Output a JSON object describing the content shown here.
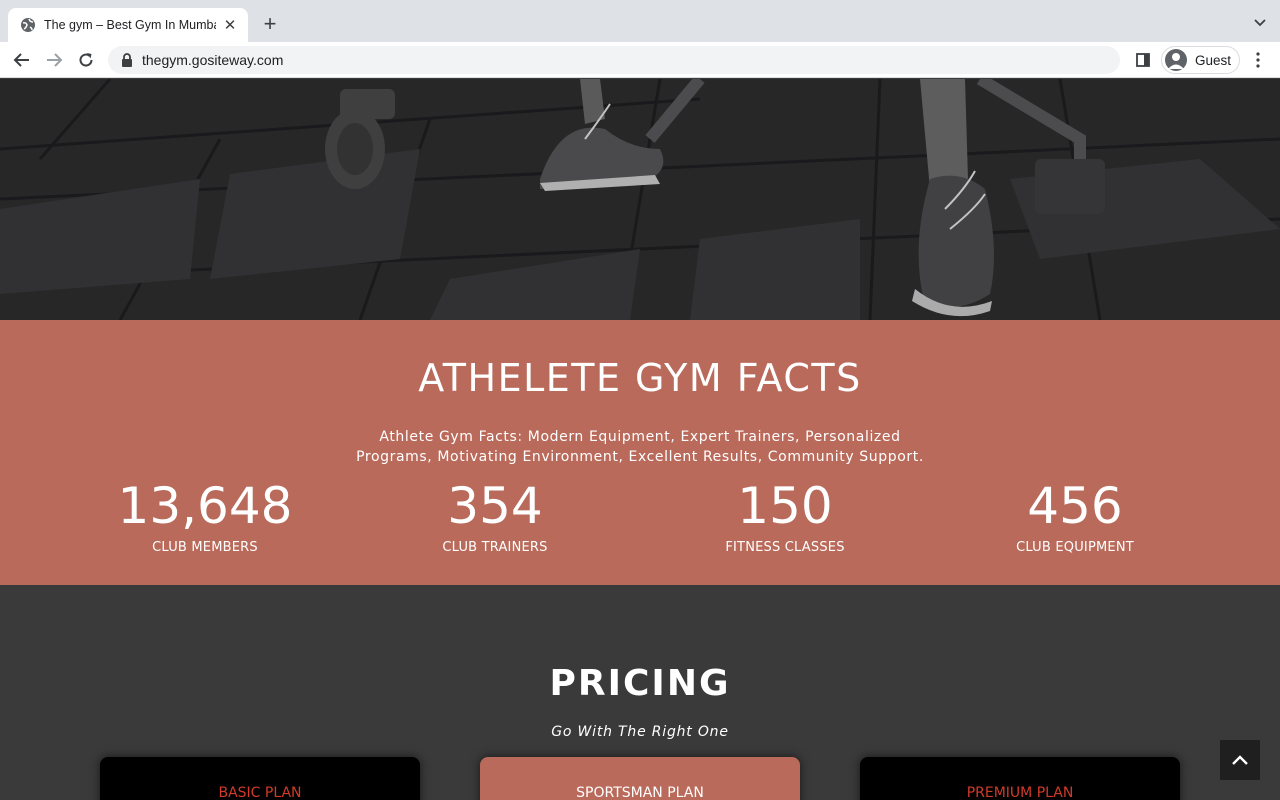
{
  "browser": {
    "tab_title": "The gym – Best Gym In Mumbai",
    "url": "thegym.gositeway.com",
    "profile_name": "Guest"
  },
  "facts": {
    "title": "ATHELETE GYM FACTS",
    "description": "Athlete Gym Facts: Modern Equipment, Expert Trainers, Personalized Programs, Motivating Environment, Excellent Results, Community Support.",
    "stats": [
      {
        "value": "13,648",
        "label": "CLUB MEMBERS"
      },
      {
        "value": "354",
        "label": "CLUB TRAINERS"
      },
      {
        "value": "150",
        "label": "FITNESS CLASSES"
      },
      {
        "value": "456",
        "label": "CLUB EQUIPMENT"
      }
    ]
  },
  "pricing": {
    "title": "PRICING",
    "subtitle": "Go With The Right One",
    "plans": [
      {
        "name": "BASIC PLAN"
      },
      {
        "name": "SPORTSMAN PLAN"
      },
      {
        "name": "PREMIUM PLAN"
      }
    ]
  },
  "colors": {
    "accent": "#b96a5a",
    "dark_bg": "#3a3a3a",
    "plan_name_red": "#d23a2a"
  },
  "icons": [
    "globe-icon",
    "close-icon",
    "plus-icon",
    "chevron-down-icon",
    "back-arrow-icon",
    "forward-arrow-icon",
    "reload-icon",
    "lock-icon",
    "side-panel-icon",
    "avatar-icon",
    "more-vert-icon",
    "chevron-up-icon"
  ]
}
